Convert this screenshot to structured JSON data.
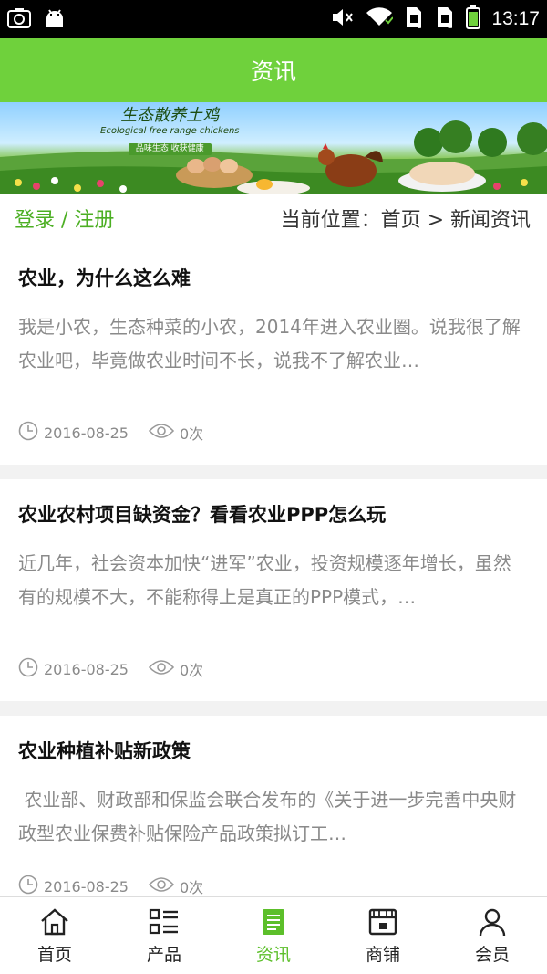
{
  "status_bar": {
    "time": "13:17"
  },
  "header": {
    "title": "资讯"
  },
  "banner": {
    "title_cn": "生态散养土鸡",
    "title_en": "Ecological free range chickens",
    "slogan": "品味生态 收获健康"
  },
  "location_bar": {
    "login_register": "登录 / 注册",
    "breadcrumb": "当前位置：首页 > 新闻资讯"
  },
  "articles": [
    {
      "title": "农业，为什么这么难",
      "summary": "我是小农，生态种菜的小农，2014年进入农业圈。说我很了解农业吧，毕竟做农业时间不长，说我不了解农业…",
      "date": "2016-08-25",
      "views": "0次"
    },
    {
      "title": "农业农村项目缺资金？看看农业PPP怎么玩",
      "summary": "近几年，社会资本加快“进军”农业，投资规模逐年增长，虽然有的规模不大，不能称得上是真正的PPP模式，…",
      "date": "2016-08-25",
      "views": "0次"
    },
    {
      "title": "农业种植补贴新政策",
      "summary": " 农业部、财政部和保监会联合发布的《关于进一步完善中央财政型农业保费补贴保险产品政策拟订工…",
      "date": "2016-08-25",
      "views": "0次"
    }
  ],
  "bottom_nav": [
    {
      "label": "首页",
      "icon": "home-icon"
    },
    {
      "label": "产品",
      "icon": "product-list-icon"
    },
    {
      "label": "资讯",
      "icon": "news-icon",
      "active": true
    },
    {
      "label": "商铺",
      "icon": "shop-icon"
    },
    {
      "label": "会员",
      "icon": "user-icon"
    }
  ],
  "colors": {
    "header_green": "#6fd13c",
    "link_green": "#4caf23",
    "active_green": "#5cbf2a"
  }
}
